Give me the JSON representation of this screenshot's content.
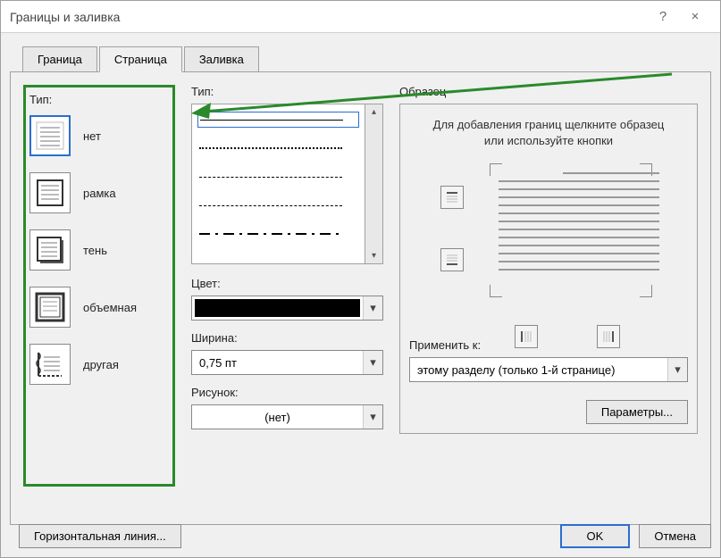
{
  "window": {
    "title": "Границы и заливка",
    "help": "?",
    "close": "×"
  },
  "tabs": {
    "border": "Граница",
    "page": "Страница",
    "fill": "Заливка"
  },
  "left": {
    "heading": "Тип:",
    "options": {
      "none": "нет",
      "box": "рамка",
      "shadow": "тень",
      "threeD": "объемная",
      "custom": "другая"
    }
  },
  "middle": {
    "style_label": "Тип:",
    "color_label": "Цвет:",
    "width_label": "Ширина:",
    "width_value": "0,75 пт",
    "art_label": "Рисунок:",
    "art_value": "(нет)"
  },
  "right": {
    "heading": "Образец",
    "hint": "Для добавления границ щелкните образец или используйте кнопки",
    "apply_label": "Применить к:",
    "apply_value": "этому разделу (только 1-й странице)",
    "params_btn": "Параметры..."
  },
  "footer": {
    "hline": "Горизонтальная линия...",
    "ok": "OK",
    "cancel": "Отмена"
  }
}
